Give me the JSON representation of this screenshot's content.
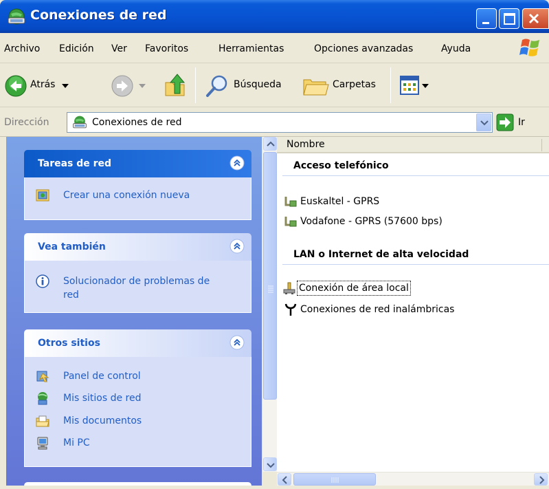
{
  "window": {
    "title": "Conexiones de red"
  },
  "menubar": {
    "items": [
      "Archivo",
      "Edición",
      "Ver",
      "Favoritos",
      "Herramientas",
      "Opciones avanzadas",
      "Ayuda"
    ]
  },
  "toolbar": {
    "back_label": "Atrás",
    "search_label": "Búsqueda",
    "folders_label": "Carpetas"
  },
  "address": {
    "label": "Dirección",
    "value": "Conexiones de red",
    "go_label": "Ir"
  },
  "sidebar": {
    "panels": [
      {
        "title": "Tareas de red",
        "items": [
          {
            "label": "Crear una conexión nueva",
            "icon": "new-connection-icon"
          }
        ]
      },
      {
        "title": "Vea también",
        "items": [
          {
            "label": "Solucionador de problemas de",
            "label2": "red",
            "icon": "info-icon"
          }
        ]
      },
      {
        "title": "Otros sitios",
        "items": [
          {
            "label": "Panel de control",
            "icon": "control-panel-icon"
          },
          {
            "label": "Mis sitios de red",
            "icon": "network-places-icon"
          },
          {
            "label": "Mis documentos",
            "icon": "my-documents-icon"
          },
          {
            "label": "Mi PC",
            "icon": "my-computer-icon"
          }
        ]
      }
    ]
  },
  "content": {
    "column_header": "Nombre",
    "groups": [
      {
        "title": "Acceso telefónico",
        "items": [
          "Euskaltel - GPRS",
          "Vodafone - GPRS (57600 bps)"
        ]
      },
      {
        "title": "LAN o Internet de alta velocidad",
        "items": [
          "Conexión de área local",
          "Conexiones de red inalámbricas"
        ]
      }
    ]
  },
  "colors": {
    "titlebar": "#0853d2",
    "sidebar_bg": "#7ba2e7",
    "link": "#215dc6"
  }
}
